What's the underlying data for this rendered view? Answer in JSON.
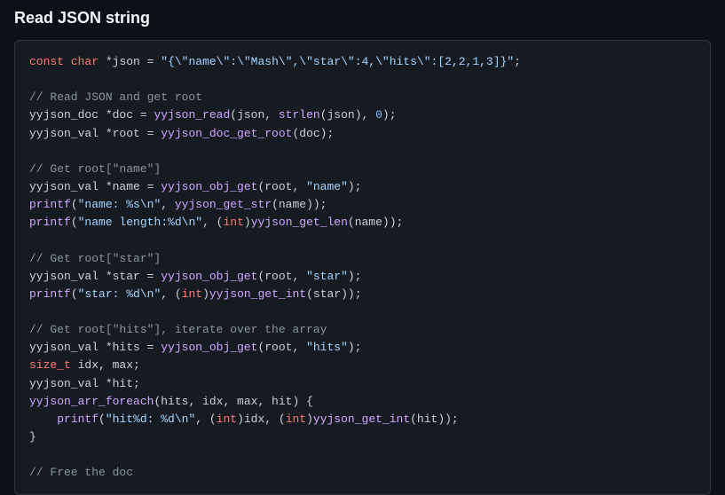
{
  "heading": "Read JSON string",
  "code": {
    "l1_a": "const",
    "l1_b": " ",
    "l1_c": "char",
    "l1_d": " *json = ",
    "l1_e": "\"{\\\"name\\\":\\\"Mash\\\",\\\"star\\\":4,\\\"hits\\\":[2,2,1,3]}\"",
    "l1_f": ";",
    "l3": "// Read JSON and get root",
    "l4_a": "yyjson_doc *doc = ",
    "l4_b": "yyjson_read",
    "l4_c": "(json, ",
    "l4_d": "strlen",
    "l4_e": "(json), ",
    "l4_f": "0",
    "l4_g": ");",
    "l5_a": "yyjson_val *root = ",
    "l5_b": "yyjson_doc_get_root",
    "l5_c": "(doc);",
    "l7": "// Get root[\"name\"]",
    "l8_a": "yyjson_val *name = ",
    "l8_b": "yyjson_obj_get",
    "l8_c": "(root, ",
    "l8_d": "\"name\"",
    "l8_e": ");",
    "l9_a": "printf",
    "l9_b": "(",
    "l9_c": "\"name: %s\\n\"",
    "l9_d": ", ",
    "l9_e": "yyjson_get_str",
    "l9_f": "(name));",
    "l10_a": "printf",
    "l10_b": "(",
    "l10_c": "\"name length:%d\\n\"",
    "l10_d": ", (",
    "l10_e": "int",
    "l10_f": ")",
    "l10_g": "yyjson_get_len",
    "l10_h": "(name));",
    "l12": "// Get root[\"star\"]",
    "l13_a": "yyjson_val *star = ",
    "l13_b": "yyjson_obj_get",
    "l13_c": "(root, ",
    "l13_d": "\"star\"",
    "l13_e": ");",
    "l14_a": "printf",
    "l14_b": "(",
    "l14_c": "\"star: %d\\n\"",
    "l14_d": ", (",
    "l14_e": "int",
    "l14_f": ")",
    "l14_g": "yyjson_get_int",
    "l14_h": "(star));",
    "l16": "// Get root[\"hits\"], iterate over the array",
    "l17_a": "yyjson_val *hits = ",
    "l17_b": "yyjson_obj_get",
    "l17_c": "(root, ",
    "l17_d": "\"hits\"",
    "l17_e": ");",
    "l18_a": "size_t",
    "l18_b": " idx, max;",
    "l19": "yyjson_val *hit;",
    "l20_a": "yyjson_arr_foreach",
    "l20_b": "(hits, idx, max, hit) {",
    "l21_a": "    ",
    "l21_b": "printf",
    "l21_c": "(",
    "l21_d": "\"hit%d: %d\\n\"",
    "l21_e": ", (",
    "l21_f": "int",
    "l21_g": ")idx, (",
    "l21_h": "int",
    "l21_i": ")",
    "l21_j": "yyjson_get_int",
    "l21_k": "(hit));",
    "l22": "}",
    "l24": "// Free the doc"
  }
}
